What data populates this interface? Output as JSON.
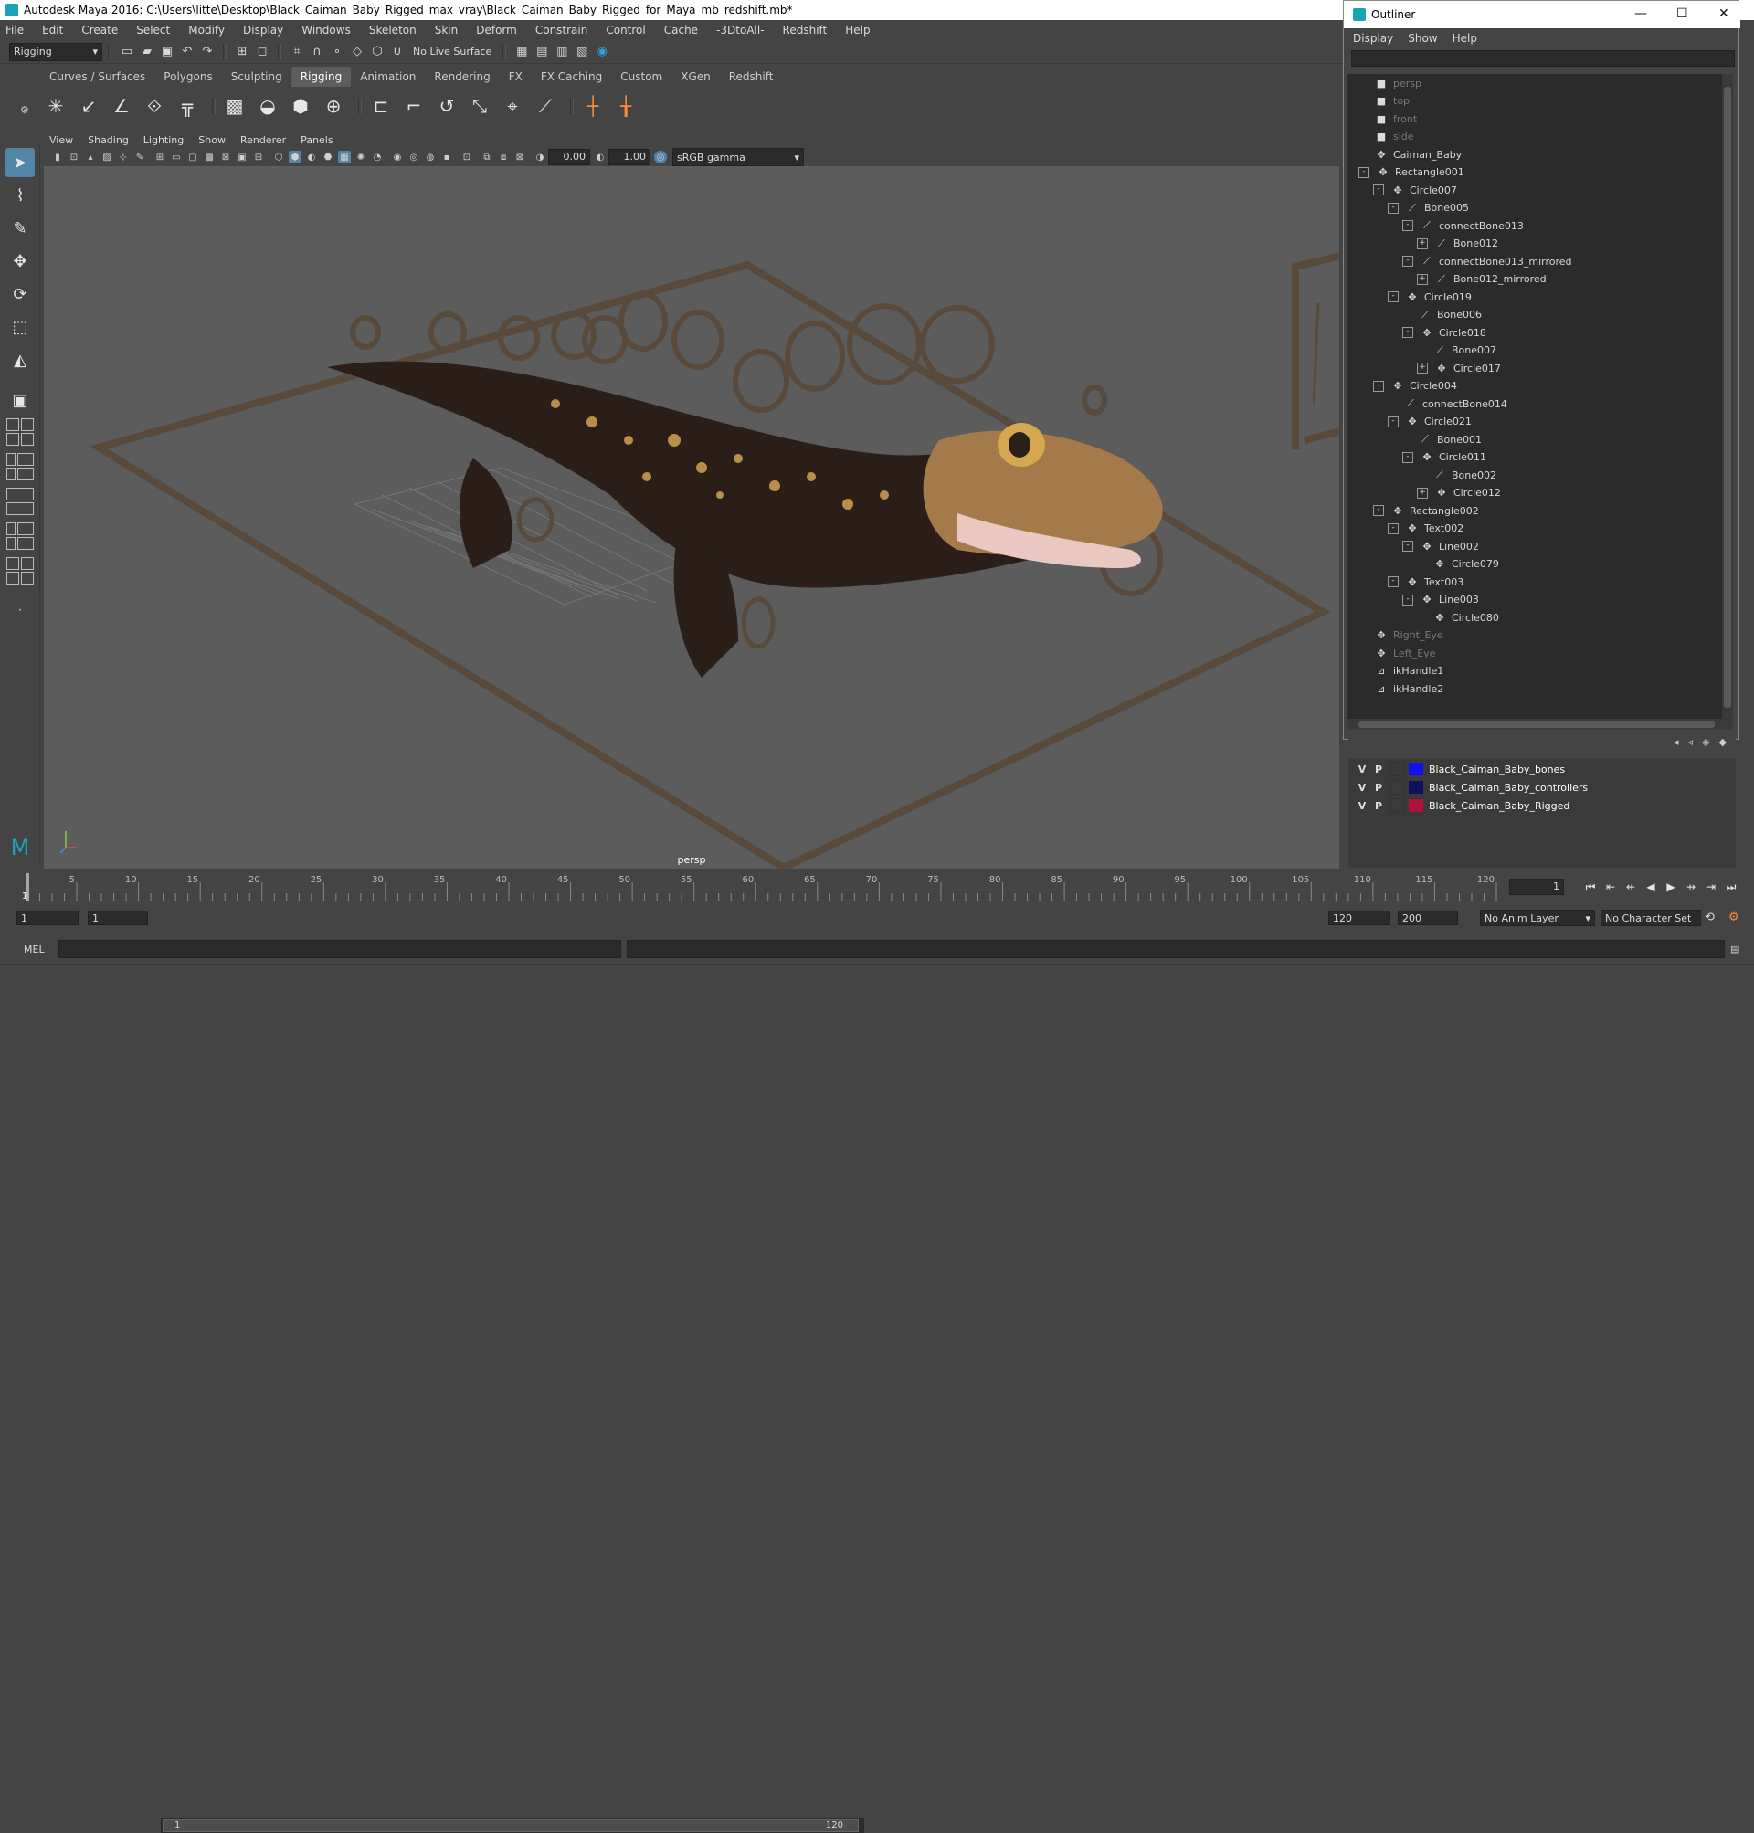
{
  "window": {
    "title": "Autodesk Maya 2016: C:\\Users\\litte\\Desktop\\Black_Caiman_Baby_Rigged_max_vray\\Black_Caiman_Baby_Rigged_for_Maya_mb_redshift.mb*"
  },
  "menus": [
    "File",
    "Edit",
    "Create",
    "Select",
    "Modify",
    "Display",
    "Windows",
    "Skeleton",
    "Skin",
    "Deform",
    "Constrain",
    "Control",
    "Cache",
    "-3DtoAll-",
    "Redshift",
    "Help"
  ],
  "statusline": {
    "mode": "Rigging",
    "live_surface": "No Live Surface"
  },
  "shelf": {
    "tabs": [
      "Curves / Surfaces",
      "Polygons",
      "Sculpting",
      "Rigging",
      "Animation",
      "Rendering",
      "FX",
      "FX Caching",
      "Custom",
      "XGen",
      "Redshift"
    ],
    "active_tab": "Rigging"
  },
  "panel": {
    "menus": [
      "View",
      "Shading",
      "Lighting",
      "Show",
      "Renderer",
      "Panels"
    ],
    "exposure": "0.00",
    "gamma": "1.00",
    "color_space": "sRGB gamma",
    "camera_label": "persp"
  },
  "outliner": {
    "title": "Outliner",
    "menus": [
      "Display",
      "Show",
      "Help"
    ],
    "items": [
      {
        "label": "persp",
        "depth": 0,
        "expander": "",
        "icon": "cam",
        "dim": true
      },
      {
        "label": "top",
        "depth": 0,
        "expander": "",
        "icon": "cam",
        "dim": true
      },
      {
        "label": "front",
        "depth": 0,
        "expander": "",
        "icon": "cam",
        "dim": true
      },
      {
        "label": "side",
        "depth": 0,
        "expander": "",
        "icon": "cam",
        "dim": true
      },
      {
        "label": "Caiman_Baby",
        "depth": 0,
        "expander": "",
        "icon": "grp",
        "dim": false
      },
      {
        "label": "Rectangle001",
        "depth": 0,
        "expander": "-",
        "icon": "grp",
        "dim": false
      },
      {
        "label": "Circle007",
        "depth": 1,
        "expander": "-",
        "icon": "grp",
        "dim": false
      },
      {
        "label": "Bone005",
        "depth": 2,
        "expander": "-",
        "icon": "jnt",
        "dim": false
      },
      {
        "label": "connectBone013",
        "depth": 3,
        "expander": "-",
        "icon": "jnt",
        "dim": false
      },
      {
        "label": "Bone012",
        "depth": 4,
        "expander": "+",
        "icon": "jnt",
        "dim": false
      },
      {
        "label": "connectBone013_mirrored",
        "depth": 3,
        "expander": "-",
        "icon": "jnt",
        "dim": false
      },
      {
        "label": "Bone012_mirrored",
        "depth": 4,
        "expander": "+",
        "icon": "jnt",
        "dim": false
      },
      {
        "label": "Circle019",
        "depth": 2,
        "expander": "-",
        "icon": "grp",
        "dim": false
      },
      {
        "label": "Bone006",
        "depth": 3,
        "expander": "",
        "icon": "jnt",
        "dim": false
      },
      {
        "label": "Circle018",
        "depth": 3,
        "expander": "-",
        "icon": "grp",
        "dim": false
      },
      {
        "label": "Bone007",
        "depth": 4,
        "expander": "",
        "icon": "jnt",
        "dim": false
      },
      {
        "label": "Circle017",
        "depth": 4,
        "expander": "+",
        "icon": "grp",
        "dim": false
      },
      {
        "label": "Circle004",
        "depth": 1,
        "expander": "-",
        "icon": "grp",
        "dim": false
      },
      {
        "label": "connectBone014",
        "depth": 2,
        "expander": "",
        "icon": "jnt",
        "dim": false
      },
      {
        "label": "Circle021",
        "depth": 2,
        "expander": "-",
        "icon": "grp",
        "dim": false
      },
      {
        "label": "Bone001",
        "depth": 3,
        "expander": "",
        "icon": "jnt",
        "dim": false
      },
      {
        "label": "Circle011",
        "depth": 3,
        "expander": "-",
        "icon": "grp",
        "dim": false
      },
      {
        "label": "Bone002",
        "depth": 4,
        "expander": "",
        "icon": "jnt",
        "dim": false
      },
      {
        "label": "Circle012",
        "depth": 4,
        "expander": "+",
        "icon": "grp",
        "dim": false
      },
      {
        "label": "Rectangle002",
        "depth": 1,
        "expander": "-",
        "icon": "grp",
        "dim": false
      },
      {
        "label": "Text002",
        "depth": 2,
        "expander": "-",
        "icon": "grp",
        "dim": false
      },
      {
        "label": "Line002",
        "depth": 3,
        "expander": "-",
        "icon": "grp",
        "dim": false
      },
      {
        "label": "Circle079",
        "depth": 4,
        "expander": "",
        "icon": "grp",
        "dim": false
      },
      {
        "label": "Text003",
        "depth": 2,
        "expander": "-",
        "icon": "grp",
        "dim": false
      },
      {
        "label": "Line003",
        "depth": 3,
        "expander": "-",
        "icon": "grp",
        "dim": false
      },
      {
        "label": "Circle080",
        "depth": 4,
        "expander": "",
        "icon": "grp",
        "dim": false
      },
      {
        "label": "Right_Eye",
        "depth": 0,
        "expander": "",
        "icon": "grp",
        "dim": true
      },
      {
        "label": "Left_Eye",
        "depth": 0,
        "expander": "",
        "icon": "grp",
        "dim": true
      },
      {
        "label": "ikHandle1",
        "depth": 0,
        "expander": "",
        "icon": "ik",
        "dim": false
      },
      {
        "label": "ikHandle2",
        "depth": 0,
        "expander": "",
        "icon": "ik",
        "dim": false
      }
    ]
  },
  "layers": [
    {
      "v": "V",
      "p": "P",
      "name": "Black_Caiman_Baby_bones",
      "color": "#1010ee"
    },
    {
      "v": "V",
      "p": "P",
      "name": "Black_Caiman_Baby_controllers",
      "color": "#101060"
    },
    {
      "v": "V",
      "p": "P",
      "name": "Black_Caiman_Baby_Rigged",
      "color": "#b0103a"
    }
  ],
  "timeline": {
    "ticks": [
      "5",
      "10",
      "15",
      "20",
      "25",
      "30",
      "35",
      "40",
      "45",
      "50",
      "55",
      "60",
      "65",
      "70",
      "75",
      "80",
      "85",
      "90",
      "95",
      "100",
      "105",
      "110",
      "115",
      "120"
    ],
    "start_label": "1",
    "current_frame": "1"
  },
  "range": {
    "start": "1",
    "start_inner": "1",
    "slider_start": "1",
    "slider_end": "120",
    "end": "120",
    "end_outer": "200",
    "anim_layer": "No Anim Layer",
    "character_set": "No Character Set"
  },
  "cmdline": {
    "language": "MEL"
  },
  "colors": {
    "accent": "#5285a6",
    "panel_bg": "#444444",
    "viewport_bg": "#5c5c5c",
    "rig_curve": "#5a4a3c"
  }
}
